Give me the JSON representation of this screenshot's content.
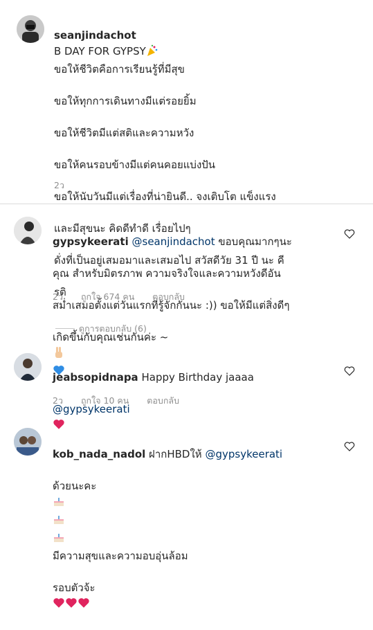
{
  "post": {
    "username": "seanjindachot",
    "title": "B DAY FOR GYPSY",
    "lines": [
      "ขอให้ชีวิตคือการเรียนรู้ที่มีสุข",
      "ขอให้ทุกการเดินทางมีแต่รอยยิ้ม",
      "ขอให้ชีวิตมีแต่สติและความหวัง",
      "ขอให้คนรอบข้างมีแต่คนคอยแบ่งปัน",
      "ขอให้นับวันมีแต่เรื่องที่น่ายินดี.. จงเติบโต แข็งแรง",
      "และมีสุขนะ คิดดีทำดี เรื่อยไปๆ",
      "ดั่งที่เป็นอยู่เสมอมาและเสมอไป  สวัสดีวัย 31 ปี นะ คี",
      "รติ"
    ],
    "time": "2ว"
  },
  "comments": [
    {
      "username": "gypsykeerati",
      "mention": "@seanjindachot",
      "text1": "ขอบคุณมากๆนะ",
      "text2": "คุณ สำหรับมิตรภาพ ความจริงใจและความหวังดีอัน",
      "text3": "สม่ำเสมอตั้งแต่วันแรกที่รู้จักกันนะ :)) ขอให้มีแต่สิ่งดีๆ",
      "text4": "เกิดขึ้นกับคุณเช่นกันค่ะ ~",
      "time": "2ว",
      "likes": "ถูกใจ 674 คน",
      "reply": "ตอบกลับ"
    },
    {
      "username": "jeabsopidnapa",
      "text1": "Happy Birthday jaaaa",
      "mention": "@gypsykeerati",
      "time": "2ว",
      "likes": "ถูกใจ 10 คน",
      "reply": "ตอบกลับ"
    },
    {
      "username": "kob_nada_nadol",
      "text1": "ฝากHBDให้",
      "mention": "@gypsykeerati",
      "text2": "ด้วยนะคะ",
      "text3": "มีความสุขและความอบอุ่นล้อม",
      "text4": "รอบตัวจ้ะ"
    }
  ],
  "view_replies": "ดูการตอบกลับ (6)"
}
